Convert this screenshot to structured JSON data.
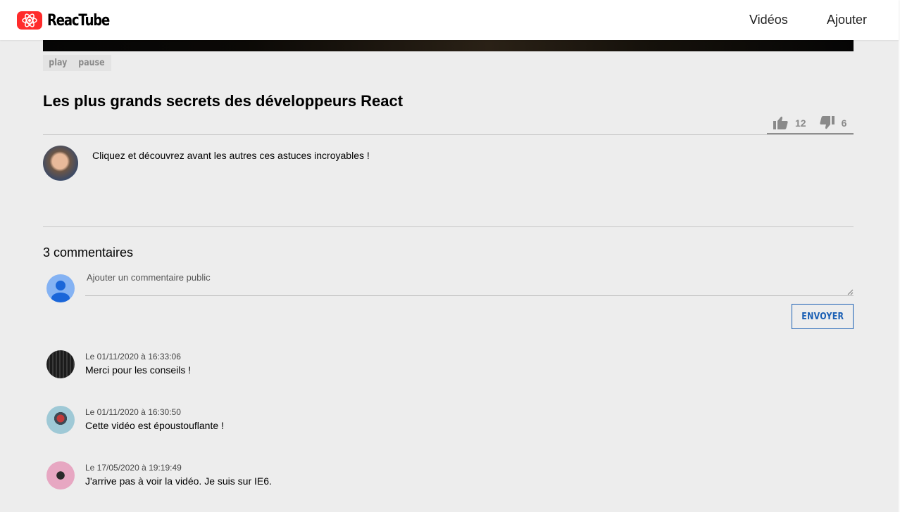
{
  "app": {
    "name": "ReacTube",
    "brand_color": "#ff2b2b",
    "logo_icon": "react-atom-icon"
  },
  "nav": {
    "videos_label": "Vidéos",
    "add_label": "Ajouter"
  },
  "player": {
    "play_label": "play",
    "pause_label": "pause"
  },
  "video": {
    "title": "Les plus grands secrets des développeurs React",
    "likes": "12",
    "dislikes": "6",
    "like_icon": "thumbs-up-icon",
    "dislike_icon": "thumbs-down-icon",
    "description": "Cliquez et découvrez avant les autres ces astuces incroyables !"
  },
  "comments_section": {
    "count_label": "3 commentaires",
    "input_placeholder": "Ajouter un commentaire public",
    "input_value": "",
    "send_label": "ENVOYER",
    "accent_color": "#1a5fb4",
    "comments": [
      {
        "date": "Le 01/11/2020 à 16:33:06",
        "text": "Merci pour les conseils !"
      },
      {
        "date": "Le 01/11/2020 à 16:30:50",
        "text": "Cette vidéo est époustouflante !"
      },
      {
        "date": "Le 17/05/2020 à 19:19:49",
        "text": "J'arrive pas à voir la vidéo. Je suis sur IE6."
      }
    ]
  }
}
